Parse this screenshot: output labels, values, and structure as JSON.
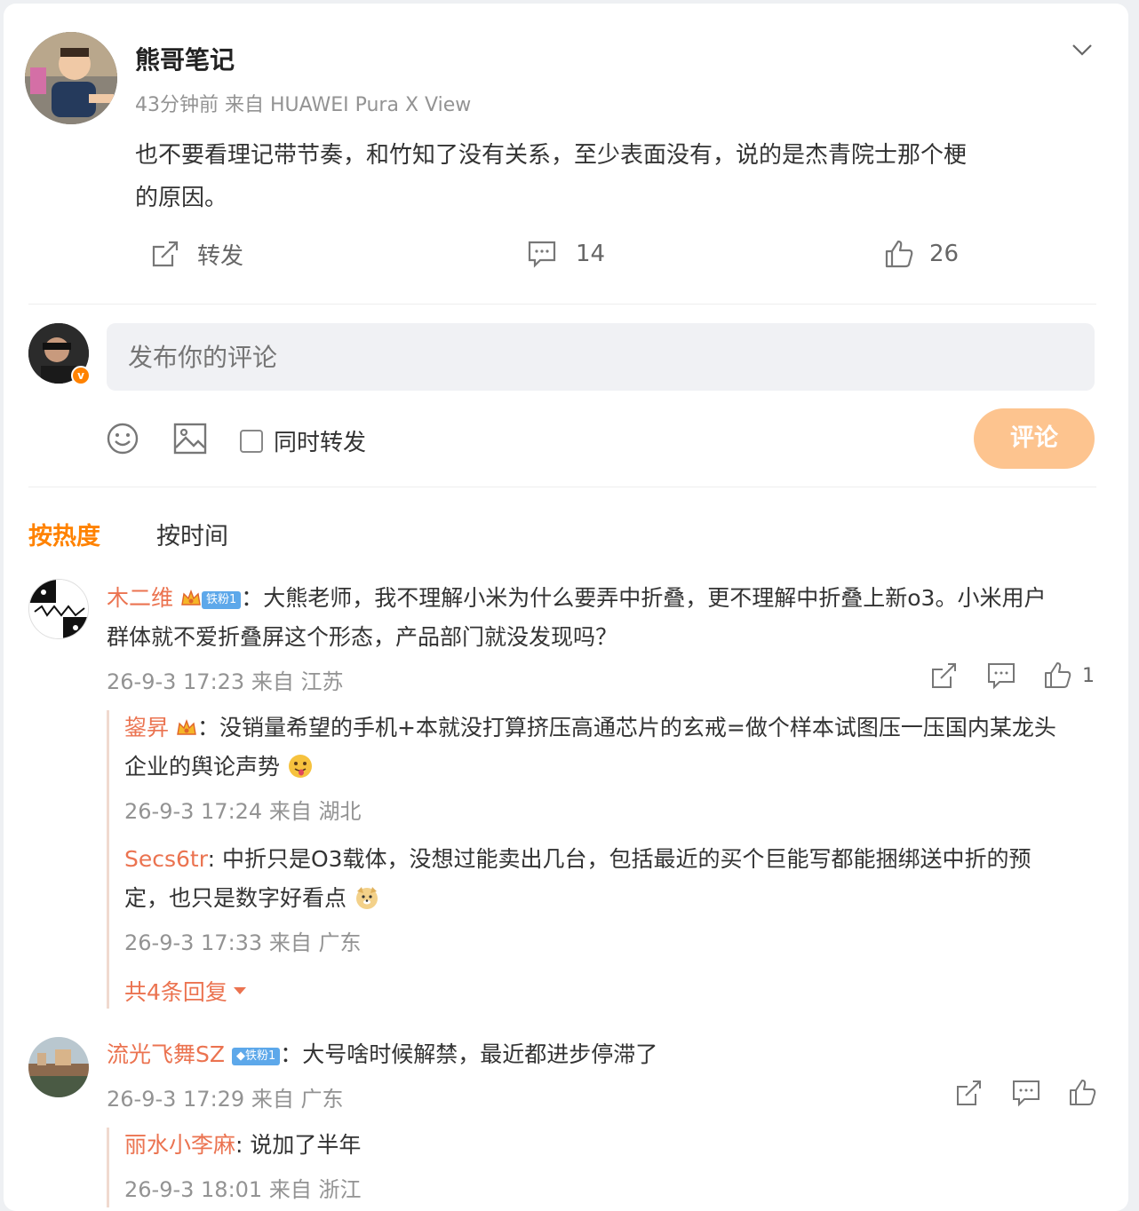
{
  "post": {
    "author": "熊哥笔记",
    "meta": "43分钟前 来自 HUAWEI Pura X View",
    "text_line1": "也不要看理记带节奏，和竹知了没有关系，至少表面没有，说的是杰青院士那个梗",
    "text_line2": "的原因。",
    "repost_label": "转发",
    "comment_count": "14",
    "like_count": "26"
  },
  "composer": {
    "placeholder": "发布你的评论",
    "also_repost_label": "同时转发",
    "submit_label": "评论"
  },
  "sort": {
    "hot_label": "按热度",
    "time_label": "按时间"
  },
  "comments": [
    {
      "user": "木二维",
      "badge": "铁粉1",
      "text_line1": "：大熊老师，我不理解小米为什么要弄中折叠，更不理解中折叠上新o3。小米用户",
      "text_line2": "群体就不爱折叠屏这个形态，产品部门就没发现吗？",
      "meta": "26-9-3 17:23 来自 江苏",
      "like_count": "1",
      "replies": [
        {
          "user": "鋆昇",
          "text_line1": "：没销量希望的手机+本就没打算挤压高通芯片的玄戒=做个样本试图压一压国内某龙头",
          "text_line2": "企业的舆论声势",
          "meta": "26-9-3 17:24 来自 湖北"
        },
        {
          "user": "Secs6tr",
          "text_line1": ": 中折只是O3载体，没想过能卖出几台，包括最近的买个巨能写都能捆绑送中折的预",
          "text_line2": "定，也只是数字好看点",
          "meta": "26-9-3 17:33 来自 广东"
        }
      ],
      "more_replies": "共4条回复"
    },
    {
      "user": "流光飞舞SZ",
      "badge": "铁粉1",
      "text_line1": "：大号啥时候解禁，最近都进步停滞了",
      "meta": "26-9-3 17:29 来自 广东",
      "replies": [
        {
          "user": "丽水小李麻",
          "text_line1": ": 说加了半年",
          "meta": "26-9-3 18:01 来自 浙江"
        }
      ]
    }
  ],
  "colors": {
    "accent": "#ff8200",
    "link": "#eb7350",
    "submit_disabled": "#fdc48f"
  }
}
